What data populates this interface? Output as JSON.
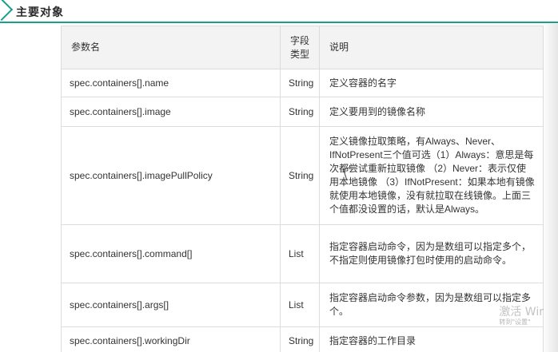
{
  "section": {
    "title": "主要对象"
  },
  "table": {
    "headers": [
      "参数名",
      "字段类型",
      "说明"
    ],
    "rows": [
      {
        "name": "spec.containers[].name",
        "type": "String",
        "desc": "定义容器的名字"
      },
      {
        "name": "spec.containers[].image",
        "type": "String",
        "desc": "定义要用到的镜像名称"
      },
      {
        "name": "spec.containers[].imagePullPolicy",
        "type": "String",
        "desc": "定义镜像拉取策略，有Always、Never、IfNotPresent三个值可选（1）Always：意思是每次都尝试重新拉取镜像 （2）Never：表示仅使用本地镜像 （3）IfNotPresent：如果本地有镜像就使用本地镜像，没有就拉取在线镜像。上面三个值都没设置的话，默认是Always。"
      },
      {
        "name": "spec.containers[].command[]",
        "type": "List",
        "desc": "指定容器启动命令，因为是数组可以指定多个，不指定则使用镜像打包时使用的启动命令。"
      },
      {
        "name": "spec.containers[].args[]",
        "type": "List",
        "desc": "指定容器启动命令参数，因为是数组可以指定多个。"
      },
      {
        "name": "spec.containers[].workingDir",
        "type": "String",
        "desc": "指定容器的工作目录"
      }
    ]
  },
  "watermark": {
    "line1": "激活 Wir",
    "line2": "转到\"设置\""
  },
  "colors": {
    "accent": "#18a08a",
    "header_bg": "#f3f3f3",
    "border": "#dcdcdc"
  }
}
